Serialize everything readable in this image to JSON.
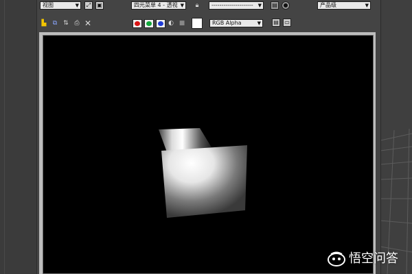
{
  "toolbar_row1": {
    "view_dropdown": {
      "value": "视图"
    },
    "render_preset_dropdown": {
      "value": "四元菜单 4 - 透视"
    },
    "named_dropdown": {
      "value": "---------------------"
    },
    "quality_dropdown": {
      "value": "产品级"
    }
  },
  "toolbar_row2": {
    "channel_dropdown": {
      "value": "RGB Alpha"
    },
    "color_channels": [
      {
        "name": "red",
        "color": "#d81414"
      },
      {
        "name": "green",
        "color": "#11a83a"
      },
      {
        "name": "blue",
        "color": "#1f3bd6"
      }
    ]
  },
  "icons": {
    "save": "save-icon",
    "copy": "copy-icon",
    "clone": "clone-icon",
    "print": "print-icon",
    "clear": "close-icon",
    "lock": "lock-icon",
    "monochrome": "monochrome-icon",
    "alpha": "alpha-icon",
    "swatch": "color-swatch-icon",
    "info": "info-panel-icon",
    "display": "display-icon"
  },
  "watermark": {
    "text": "悟空问答"
  }
}
